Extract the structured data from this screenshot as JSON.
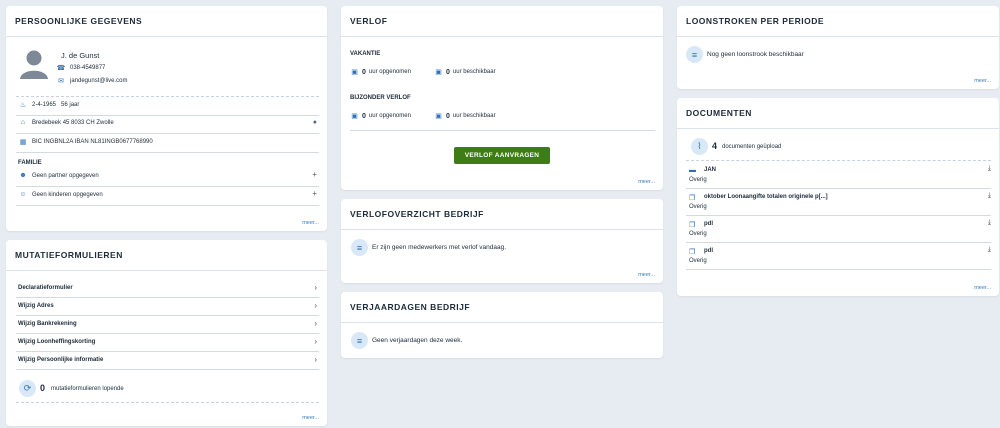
{
  "personal": {
    "title": "PERSOONLIJKE GEGEVENS",
    "name": "J. de Gunst",
    "phone": "038-4549877",
    "email": "jandegunst@live.com",
    "birthdate": "2-4-1965",
    "age": "56 jaar",
    "address": "Bredebeek 45 8033 CH Zwolle",
    "bank": "BIC INGBNL2A IBAN NL81INGB0677768990",
    "family_heading": "FAMILIE",
    "partner": "Geen partner opgegeven",
    "children": "Geen kinderen opgegeven",
    "more": "meer..."
  },
  "mutatie": {
    "title": "MUTATIEFORMULIEREN",
    "items": [
      "Declaratieformulier",
      "Wijzig Adres",
      "Wijzig Bankrekening",
      "Wijzig Loonheffingskorting",
      "Wijzig Persoonlijke informatie"
    ],
    "count": "0",
    "count_label": "mutatieformulieren lopende",
    "more": "meer..."
  },
  "verlof": {
    "title": "VERLOF",
    "vakantie": "VAKANTIE",
    "bijzonder": "BIJZONDER VERLOF",
    "taken_value": "0",
    "taken_label": "uur opgenomen",
    "avail_value": "0",
    "avail_label": "uur beschikbaar",
    "button": "VERLOF AANVRAGEN",
    "more": "meer..."
  },
  "overzicht": {
    "title": "VERLOFOVERZICHT BEDRIJF",
    "text": "Er zijn geen medewerkers met verlof vandaag.",
    "more": "meer..."
  },
  "verjaardagen": {
    "title": "VERJAARDAGEN BEDRIJF",
    "text": "Geen verjaardagen deze week."
  },
  "loonstroken": {
    "title": "LOONSTROKEN PER PERIODE",
    "text": "Nog geen loonstrook beschikbaar",
    "more": "meer..."
  },
  "documenten": {
    "title": "DOCUMENTEN",
    "count": "4",
    "count_label": "documenten geüpload",
    "items": [
      {
        "name": "JAN",
        "cat": "Overig"
      },
      {
        "name": "oktober Loonaangifte totalen originele p[...]",
        "cat": "Overig"
      },
      {
        "name": "pdl",
        "cat": "Overig"
      },
      {
        "name": "pdl",
        "cat": "Overig"
      }
    ],
    "more": "meer..."
  }
}
